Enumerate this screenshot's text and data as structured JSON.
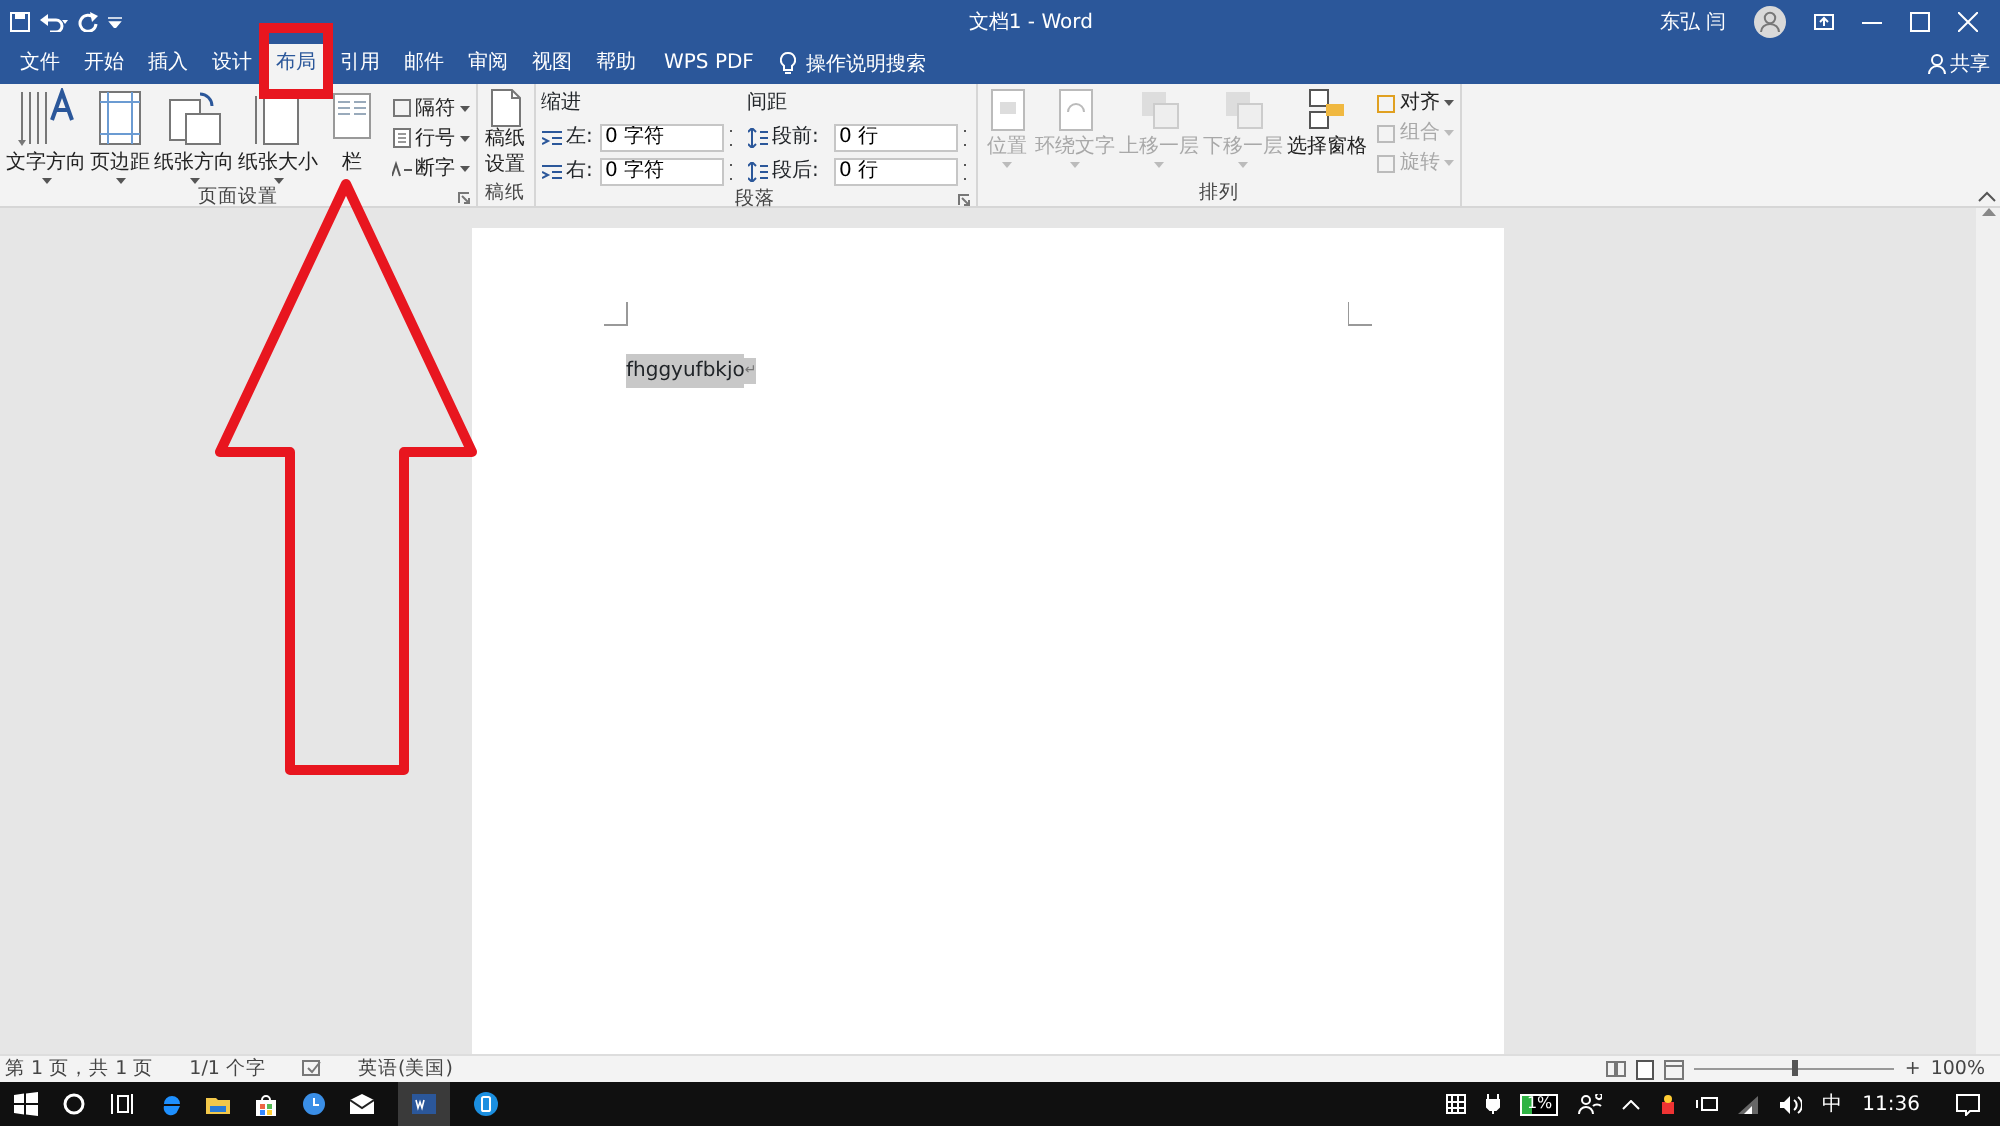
{
  "window": {
    "title": "文档1 - Word",
    "user": "东弘 闫"
  },
  "tabs": [
    {
      "label": "文件",
      "selected": false
    },
    {
      "label": "开始",
      "selected": false
    },
    {
      "label": "插入",
      "selected": false
    },
    {
      "label": "设计",
      "selected": false
    },
    {
      "label": "布局",
      "selected": true
    },
    {
      "label": "引用",
      "selected": false
    },
    {
      "label": "邮件",
      "selected": false
    },
    {
      "label": "审阅",
      "selected": false
    },
    {
      "label": "视图",
      "selected": false
    },
    {
      "label": "帮助",
      "selected": false
    },
    {
      "label": "WPS PDF",
      "selected": false
    }
  ],
  "search": {
    "label": "操作说明搜索"
  },
  "share": {
    "label": "共享"
  },
  "page_setup": {
    "label": "页面设置",
    "large_buttons": [
      {
        "label": "文字方向"
      },
      {
        "label": "页边距"
      },
      {
        "label": "纸张方向"
      },
      {
        "label": "纸张大小"
      },
      {
        "label": "栏"
      }
    ],
    "small_buttons": [
      {
        "label": "隔符"
      },
      {
        "label": "行号"
      },
      {
        "label": "断字"
      }
    ]
  },
  "manuscript": {
    "label": "稿纸",
    "button": "稿纸设置"
  },
  "paragraph": {
    "label": "段落",
    "indent": {
      "title": "缩进",
      "fields": [
        {
          "label": "左:",
          "value": "0 字符"
        },
        {
          "label": "右:",
          "value": "0 字符"
        }
      ]
    },
    "spacing": {
      "title": "间距",
      "fields": [
        {
          "label": "段前:",
          "value": "0 行"
        },
        {
          "label": "段后:",
          "value": "0 行"
        }
      ]
    }
  },
  "arrange": {
    "label": "排列",
    "large_buttons": [
      {
        "label": "位置",
        "disabled": true
      },
      {
        "label": "环绕文字",
        "disabled": true
      },
      {
        "label": "上移一层",
        "disabled": true
      },
      {
        "label": "下移一层",
        "disabled": true
      },
      {
        "label": "选择窗格",
        "disabled": false
      }
    ],
    "small_buttons": [
      {
        "label": "对齐",
        "disabled": false
      },
      {
        "label": "组合",
        "disabled": true
      },
      {
        "label": "旋转",
        "disabled": true
      }
    ]
  },
  "document": {
    "text": "fhggyufbkjo",
    "selected": true,
    "para_mark": "↵"
  },
  "status_bar": {
    "page": "第 1 页，共 1 页",
    "words": "1/1 个字",
    "language": "英语(美国)",
    "zoom_slider": {
      "level": 0.5
    },
    "zoom_plus": "+",
    "zoom": "100%"
  },
  "taskbar": {
    "battery": "1%",
    "ime": "中",
    "time": "11:36"
  }
}
